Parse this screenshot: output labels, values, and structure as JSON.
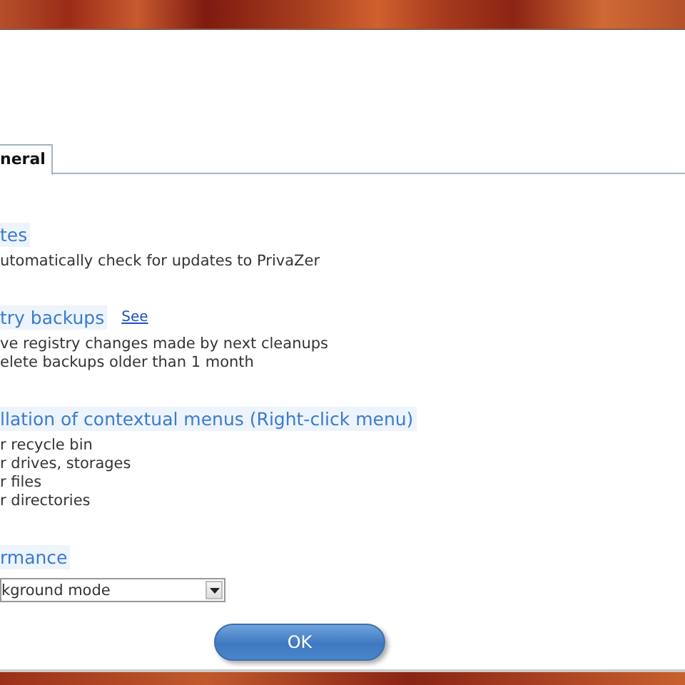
{
  "tabs": [
    {
      "label": "neral",
      "selected": true
    }
  ],
  "sections": [
    {
      "heading": "tes",
      "items": [
        "utomatically check for updates to PrivaZer"
      ]
    },
    {
      "heading": "try backups",
      "link": "See",
      "items": [
        "ve registry changes made by next cleanups",
        "elete backups older than 1 month"
      ]
    },
    {
      "heading": "llation of contextual menus (Right-click menu)",
      "items": [
        "r recycle bin",
        "r drives, storages",
        "r files",
        "r directories"
      ]
    },
    {
      "heading": "rmance",
      "dropdown": {
        "value": "kground mode"
      }
    }
  ],
  "buttons": [
    "OK"
  ]
}
